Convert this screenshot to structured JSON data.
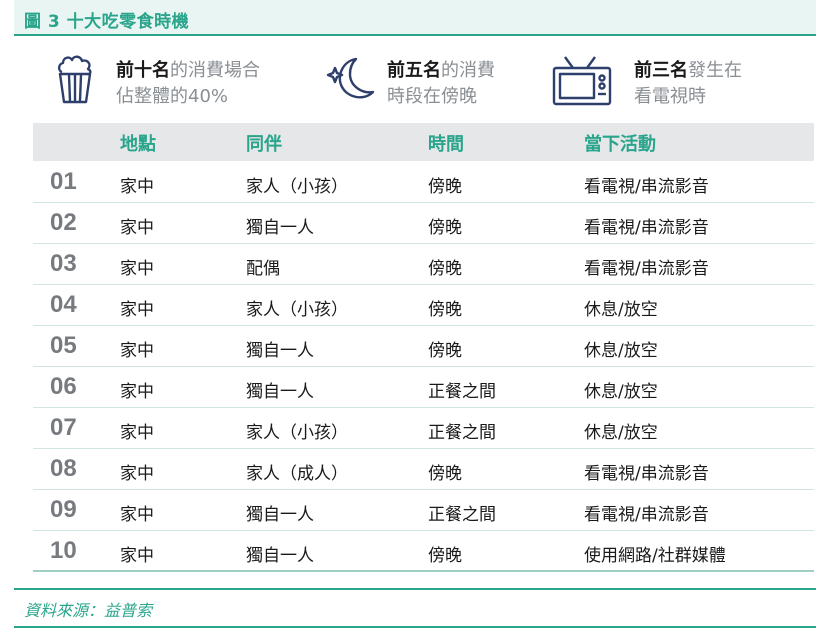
{
  "header": {
    "title": "圖 3  十大吃零食時機"
  },
  "stats": [
    {
      "icon": "popcorn-icon",
      "line1_strong": "前十名",
      "line1_soft": "的消費場合",
      "line2": "佔整體的40%"
    },
    {
      "icon": "moon-star-icon",
      "line1_strong": "前五名",
      "line1_soft": "的消費",
      "line2": "時段在傍晚"
    },
    {
      "icon": "television-icon",
      "line1_strong": "前三名",
      "line1_soft": "發生在",
      "line2": "看電視時"
    }
  ],
  "table": {
    "headers": [
      "地點",
      "同伴",
      "時間",
      "當下活動"
    ],
    "rows": [
      {
        "rank": "01",
        "place": "家中",
        "company": "家人（小孩）",
        "time": "傍晚",
        "activity": "看電視/串流影音"
      },
      {
        "rank": "02",
        "place": "家中",
        "company": "獨自一人",
        "time": "傍晚",
        "activity": "看電視/串流影音"
      },
      {
        "rank": "03",
        "place": "家中",
        "company": "配偶",
        "time": "傍晚",
        "activity": "看電視/串流影音"
      },
      {
        "rank": "04",
        "place": "家中",
        "company": "家人（小孩）",
        "time": "傍晚",
        "activity": "休息/放空"
      },
      {
        "rank": "05",
        "place": "家中",
        "company": "獨自一人",
        "time": "傍晚",
        "activity": "休息/放空"
      },
      {
        "rank": "06",
        "place": "家中",
        "company": "獨自一人",
        "time": "正餐之間",
        "activity": "休息/放空"
      },
      {
        "rank": "07",
        "place": "家中",
        "company": "家人（小孩）",
        "time": "正餐之間",
        "activity": "休息/放空"
      },
      {
        "rank": "08",
        "place": "家中",
        "company": "家人（成人）",
        "time": "傍晚",
        "activity": "看電視/串流影音"
      },
      {
        "rank": "09",
        "place": "家中",
        "company": "獨自一人",
        "time": "正餐之間",
        "activity": "看電視/串流影音"
      },
      {
        "rank": "10",
        "place": "家中",
        "company": "獨自一人",
        "time": "傍晚",
        "activity": "使用網路/社群媒體"
      }
    ]
  },
  "footer": {
    "source": "資料來源：益普索"
  },
  "colors": {
    "accent": "#2aa58c",
    "navy": "#2e3f6b",
    "muted": "#8a8f94"
  }
}
